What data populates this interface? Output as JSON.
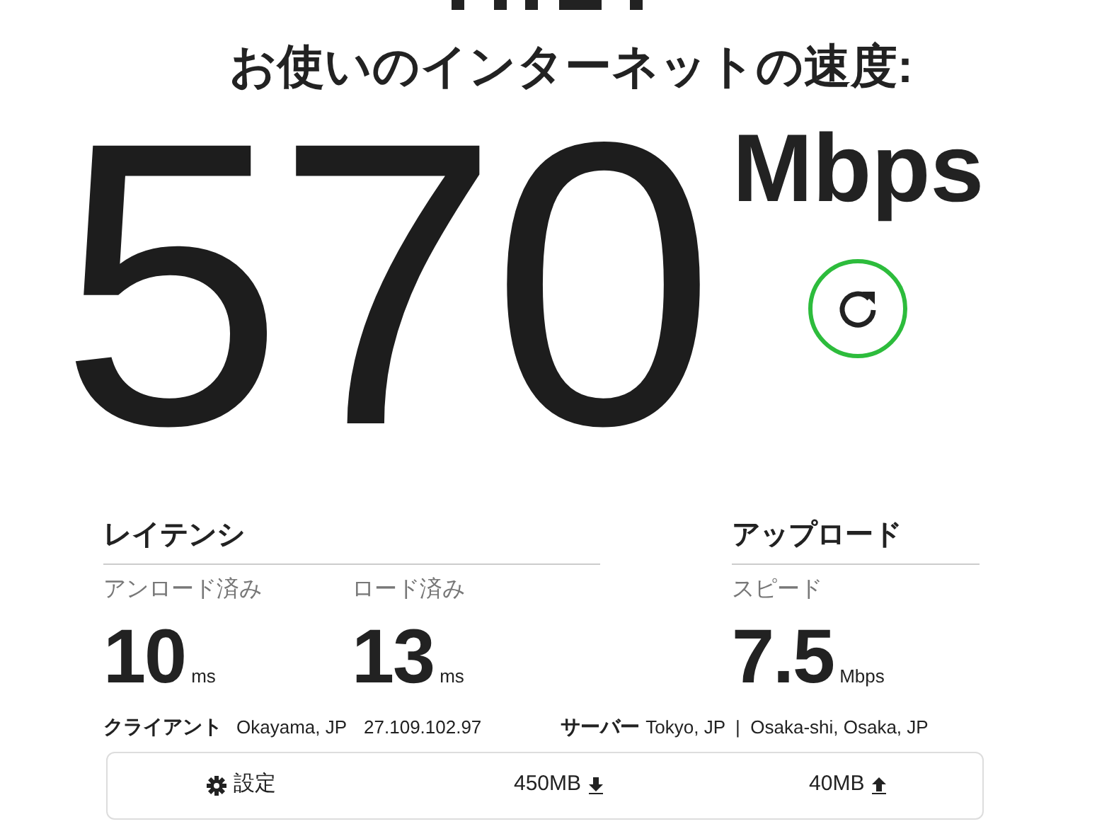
{
  "heading": "お使いのインターネットの速度:",
  "speed": {
    "value": "570",
    "unit": "Mbps"
  },
  "latency": {
    "title": "レイテンシ",
    "metrics": [
      {
        "label": "アンロード済み",
        "value": "10",
        "unit": "ms"
      },
      {
        "label": "ロード済み",
        "value": "13",
        "unit": "ms"
      }
    ]
  },
  "upload": {
    "title": "アップロード",
    "metrics": [
      {
        "label": "スピード",
        "value": "7.5",
        "unit": "Mbps"
      }
    ]
  },
  "client": {
    "label": "クライアント",
    "location": "Okayama, JP",
    "ip": "27.109.102.97"
  },
  "server": {
    "label": "サーバー",
    "locations": "Tokyo, JP  |  Osaka-shi, Osaka, JP"
  },
  "footer": {
    "settings": "設定",
    "download_size": "450MB",
    "upload_size": "40MB"
  }
}
